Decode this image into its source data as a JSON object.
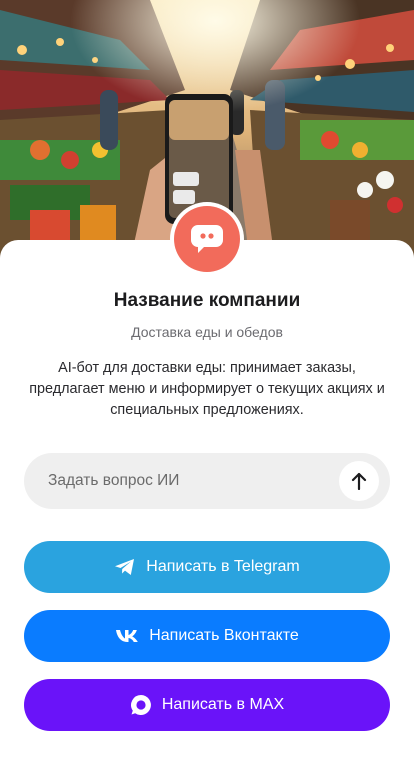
{
  "company": {
    "name": "Название компании",
    "tagline": "Доставка еды и обедов",
    "description": "AI-бот для доставки еды: принимает заказы, предлагает меню и информирует о текущих акциях и специальных предложениях.",
    "logo_color": "#F26B5B",
    "logo_icon": "chat-bubble-icon"
  },
  "ask": {
    "placeholder": "Задать вопрос ИИ",
    "value": "",
    "send_icon": "arrow-up-icon"
  },
  "buttons": [
    {
      "label": "Написать в Telegram",
      "icon": "telegram-icon",
      "color": "#2AA3DF"
    },
    {
      "label": "Написать Вконтакте",
      "icon": "vk-icon",
      "color": "#0A7CFF"
    },
    {
      "label": "Написать в MAX",
      "icon": "max-icon",
      "color": "#6A13F9"
    }
  ],
  "hero": {
    "alt_subject": "market-photo"
  }
}
